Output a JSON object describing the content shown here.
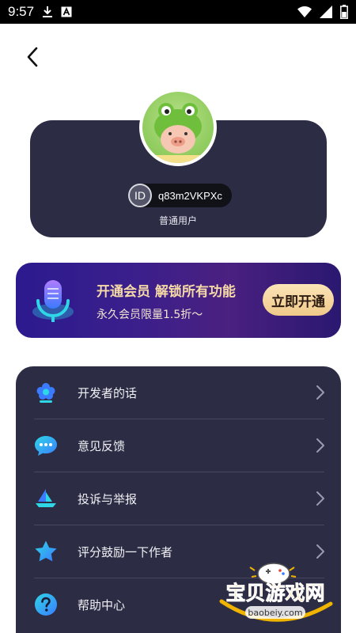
{
  "status_bar": {
    "time": "9:57",
    "icons_left": [
      "download-icon",
      "a-box-icon"
    ],
    "icons_right": [
      "wifi-icon",
      "signal-icon",
      "battery-icon"
    ]
  },
  "profile": {
    "avatar_icon": "frog-pig-avatar",
    "id_badge": "ID",
    "id_value": "q83m2VKPXc",
    "user_type": "普通用户"
  },
  "vip_banner": {
    "title": "开通会员 解锁所有功能",
    "subtitle": "永久会员限量1.5折～",
    "button_label": "立即开通",
    "icon": "microphone-icon"
  },
  "menu": {
    "items": [
      {
        "label": "开发者的话",
        "icon": "flower-icon"
      },
      {
        "label": "意见反馈",
        "icon": "chat-bubble-icon"
      },
      {
        "label": "投诉与举报",
        "icon": "paper-boat-icon"
      },
      {
        "label": "评分鼓励一下作者",
        "icon": "star-icon"
      },
      {
        "label": "帮助中心",
        "icon": "question-icon"
      }
    ]
  },
  "watermark": {
    "text": "宝贝游戏网",
    "url": "baobeiy.com"
  },
  "colors": {
    "card_bg": "#2c2c45",
    "accent_cyan": "#2fd6e6",
    "accent_blue": "#3a7bff",
    "gold": "#f5d9a6"
  }
}
